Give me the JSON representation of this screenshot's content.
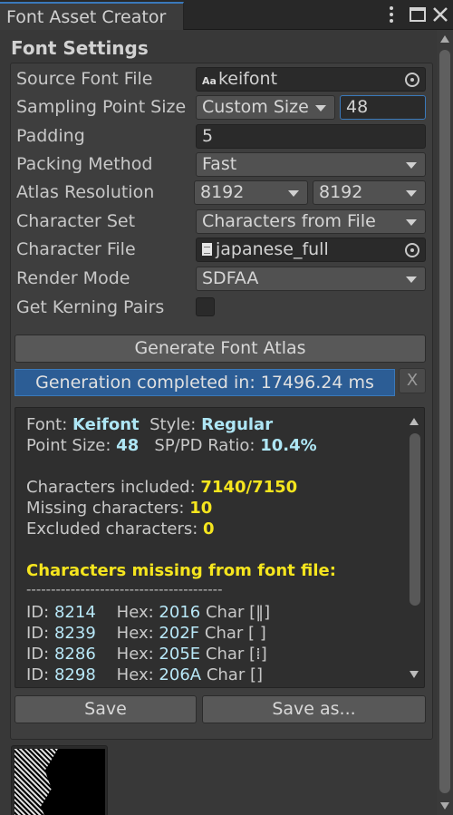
{
  "window": {
    "tab_title": "Font Asset Creator",
    "menu_icon": "vertical-dots-icon",
    "maximize_icon": "maximize-icon",
    "close_icon": "close-icon"
  },
  "section_title": "Font Settings",
  "settings": {
    "source_font_file": {
      "label": "Source Font File",
      "value": "keifont",
      "icon_text": "Aa"
    },
    "sampling_point_size": {
      "label": "Sampling Point Size",
      "mode": "Custom Size",
      "value": "48"
    },
    "padding": {
      "label": "Padding",
      "value": "5"
    },
    "packing_method": {
      "label": "Packing Method",
      "value": "Fast"
    },
    "atlas_resolution": {
      "label": "Atlas Resolution",
      "width": "8192",
      "height": "8192"
    },
    "character_set": {
      "label": "Character Set",
      "value": "Characters from File"
    },
    "character_file": {
      "label": "Character File",
      "value": "japanese_full"
    },
    "render_mode": {
      "label": "Render Mode",
      "value": "SDFAA"
    },
    "get_kerning_pairs": {
      "label": "Get Kerning Pairs",
      "checked": false
    }
  },
  "generate_button": "Generate Font Atlas",
  "progress": {
    "text": "Generation completed in: 17496.24 ms",
    "percent": 100,
    "close": "X"
  },
  "output": {
    "font_label": "Font:",
    "font_value": "Keifont",
    "style_label": "Style:",
    "style_value": "Regular",
    "point_size_label": "Point Size:",
    "point_size_value": "48",
    "ratio_label": "SP/PD Ratio:",
    "ratio_value": "10.4%",
    "included_label": "Characters included:",
    "included_value": "7140/7150",
    "missing_label": "Missing characters:",
    "missing_value": "10",
    "excluded_label": "Excluded characters:",
    "excluded_value": "0",
    "missing_header": "Characters missing from font file:",
    "separator": "----------------------------------------",
    "rows": [
      {
        "id": "8214",
        "hex": "2016",
        "char": "‖"
      },
      {
        "id": "8239",
        "hex": "202F",
        "char": " "
      },
      {
        "id": "8286",
        "hex": "205E",
        "char": "⁞"
      },
      {
        "id": "8298",
        "hex": "206A",
        "char": "⁪"
      }
    ],
    "id_label": "ID:",
    "hex_label": "Hex:",
    "char_label": "Char"
  },
  "save_button": "Save",
  "save_as_button": "Save as..."
}
